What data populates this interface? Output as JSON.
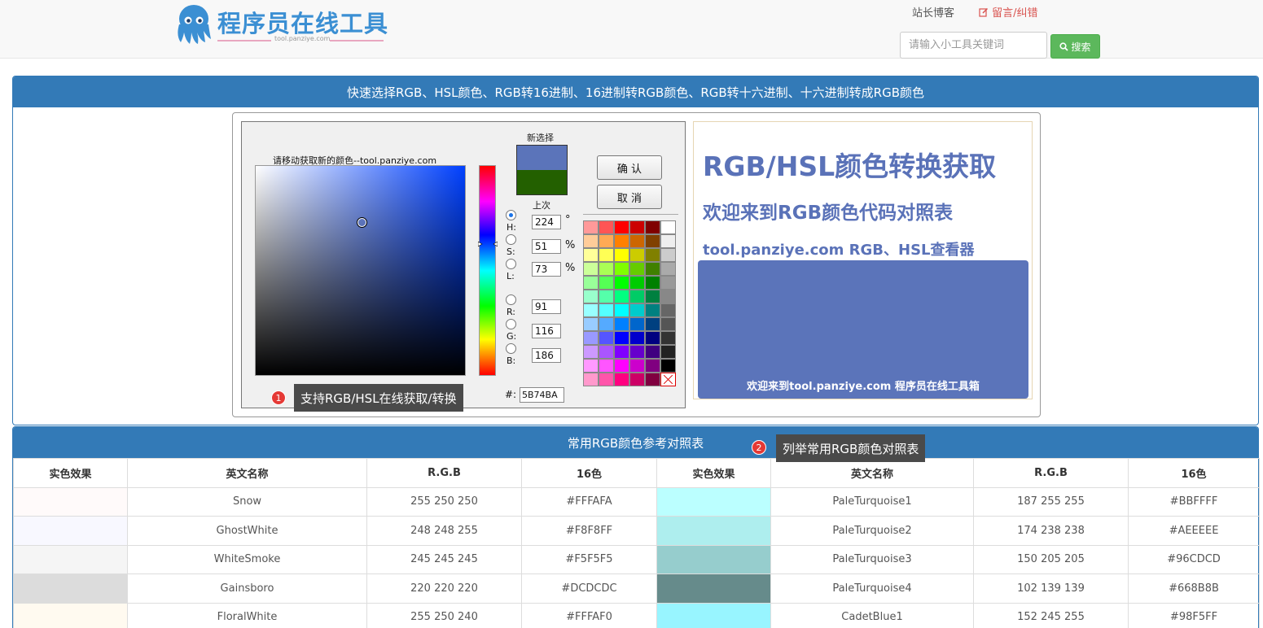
{
  "header": {
    "logo_title": "程序员在线工具",
    "logo_sub": "tool.panziye.com",
    "nav_blog": "站长博客",
    "nav_feedback": "留言/纠错",
    "search_placeholder": "请输入小工具关键词",
    "search_button": "搜索"
  },
  "picker_panel": {
    "title": "快速选择RGB、HSL颜色、RGB转16进制、16进制转RGB颜色、RGB转十六进制、十六进制转成RGB颜色",
    "picker_caption": "请移动获取新的颜色--tool.panziye.com",
    "new_label": "新选择",
    "old_label": "上次",
    "new_color": "#5B74BA",
    "old_color": "#236000",
    "confirm_button": "确 认",
    "cancel_button": "取 消",
    "fields": {
      "h_label": "H:",
      "h_value": "224",
      "h_unit": "°",
      "s_label": "S:",
      "s_value": "51",
      "s_unit": "%",
      "l_label": "L:",
      "l_value": "73",
      "l_unit": "%",
      "r_label": "R:",
      "r_value": "91",
      "g_label": "G:",
      "g_value": "116",
      "b_label": "B:",
      "b_value": "186",
      "hex_label": "#:",
      "hex_value": "5B74BA"
    },
    "palette": [
      "#ff9999",
      "#ff5555",
      "#ff0000",
      "#cc0000",
      "#800000",
      "#ffffff",
      "#ffcc99",
      "#ffaa55",
      "#ff8000",
      "#cc6600",
      "#804000",
      "#eeeeee",
      "#ffff99",
      "#ffff55",
      "#ffff00",
      "#cccc00",
      "#808000",
      "#cccccc",
      "#ccff99",
      "#aaff55",
      "#80ff00",
      "#66cc00",
      "#408000",
      "#aaaaaa",
      "#99ff99",
      "#55ff55",
      "#00ff00",
      "#00cc00",
      "#008000",
      "#999999",
      "#99ffcc",
      "#55ffaa",
      "#00ff80",
      "#00cc66",
      "#008040",
      "#888888",
      "#99ffff",
      "#55ffff",
      "#00ffff",
      "#00cccc",
      "#008080",
      "#666666",
      "#99ccff",
      "#55aaff",
      "#0080ff",
      "#0066cc",
      "#004080",
      "#555555",
      "#9999ff",
      "#5555ff",
      "#0000ff",
      "#0000cc",
      "#000080",
      "#333333",
      "#cc99ff",
      "#aa55ff",
      "#8000ff",
      "#6600cc",
      "#400080",
      "#222222",
      "#ff99ff",
      "#ff55ff",
      "#ff00ff",
      "#cc00cc",
      "#800080",
      "#000000",
      "#ff99cc",
      "#ff55aa",
      "#ff0080",
      "#cc0066",
      "#800040",
      "none"
    ],
    "preview": {
      "h1": "RGB/HSL颜色转换获取",
      "h2": "欢迎来到RGB颜色代码对照表",
      "h3": "tool.panziye.com RGB、HSL查看器",
      "block_text": "欢迎来到tool.panziye.com 程序员在线工具箱",
      "block_color": "#5B74BA"
    }
  },
  "tips": {
    "tip1_num": "1",
    "tip1_text": "支持RGB/HSL在线获取/转换",
    "tip2_num": "2",
    "tip2_text": "列举常用RGB颜色对照表"
  },
  "table_panel": {
    "title": "常用RGB颜色参考对照表",
    "headers": [
      "实色效果",
      "英文名称",
      "R.G.B",
      "16色",
      "实色效果",
      "英文名称",
      "R.G.B",
      "16色"
    ],
    "rows": [
      {
        "l_color": "#FFFAFA",
        "l_name": "Snow",
        "l_rgb": "255 250 250",
        "l_hex": "#FFFAFA",
        "r_color": "#BBFFFF",
        "r_name": "PaleTurquoise1",
        "r_rgb": "187 255 255",
        "r_hex": "#BBFFFF"
      },
      {
        "l_color": "#F8F8FF",
        "l_name": "GhostWhite",
        "l_rgb": "248 248 255",
        "l_hex": "#F8F8FF",
        "r_color": "#AEEEEE",
        "r_name": "PaleTurquoise2",
        "r_rgb": "174 238 238",
        "r_hex": "#AEEEEE"
      },
      {
        "l_color": "#F5F5F5",
        "l_name": "WhiteSmoke",
        "l_rgb": "245 245 245",
        "l_hex": "#F5F5F5",
        "r_color": "#96CDCD",
        "r_name": "PaleTurquoise3",
        "r_rgb": "150 205 205",
        "r_hex": "#96CDCD"
      },
      {
        "l_color": "#DCDCDC",
        "l_name": "Gainsboro",
        "l_rgb": "220 220 220",
        "l_hex": "#DCDCDC",
        "r_color": "#668B8B",
        "r_name": "PaleTurquoise4",
        "r_rgb": "102 139 139",
        "r_hex": "#668B8B"
      },
      {
        "l_color": "#FFFAF0",
        "l_name": "FloralWhite",
        "l_rgb": "255 250 240",
        "l_hex": "#FFFAF0",
        "r_color": "#98F5FF",
        "r_name": "CadetBlue1",
        "r_rgb": "152 245 255",
        "r_hex": "#98F5FF"
      }
    ]
  }
}
